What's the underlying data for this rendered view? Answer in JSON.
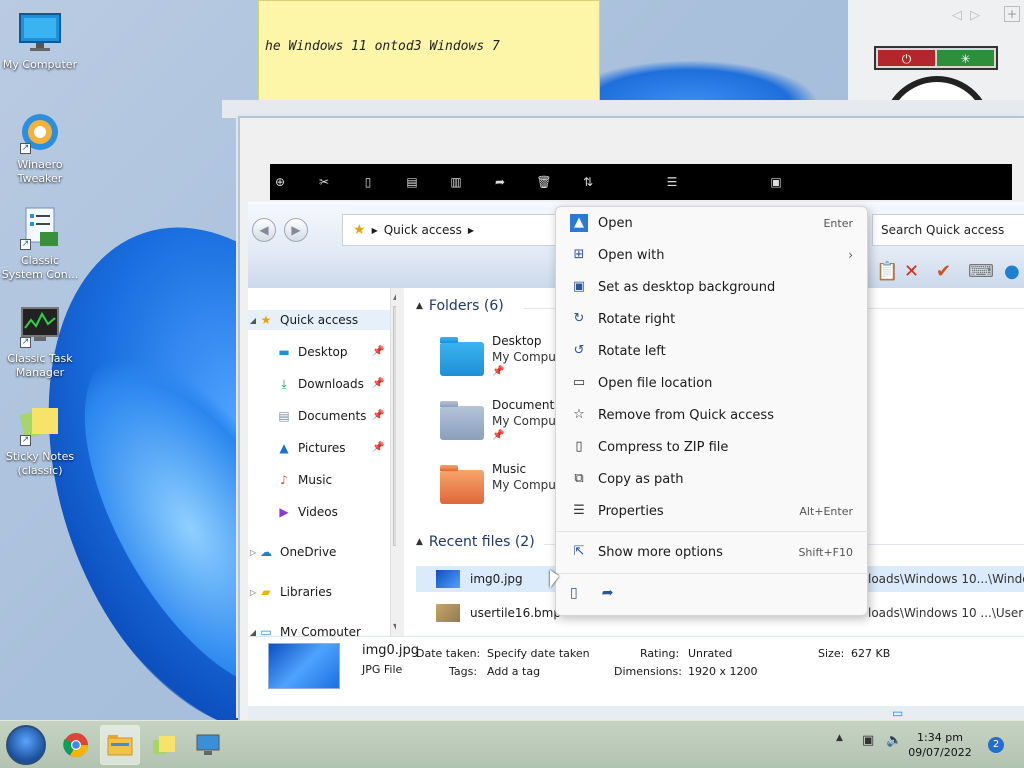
{
  "desktop": {
    "icons": [
      {
        "label": "My Computer",
        "icon": "monitor-icon"
      },
      {
        "label": "Winaero Tweaker",
        "icon": "winaero-icon"
      },
      {
        "label": "Classic System Con...",
        "icon": "control-panel-icon"
      },
      {
        "label": "Classic Task Manager",
        "icon": "task-manager-icon"
      },
      {
        "label": "Sticky Notes (classic)",
        "icon": "sticky-notes-icon"
      }
    ]
  },
  "sticky_note": {
    "text": "he Windows 11 ontod3 Windows 7"
  },
  "explorer": {
    "address": {
      "location": "Quick access"
    },
    "search": {
      "placeholder": "Search Quick access"
    },
    "nav": {
      "items": [
        {
          "label": "Quick access",
          "pinned": false
        },
        {
          "label": "Desktop",
          "pinned": true
        },
        {
          "label": "Downloads",
          "pinned": true
        },
        {
          "label": "Documents",
          "pinned": true
        },
        {
          "label": "Pictures",
          "pinned": true
        },
        {
          "label": "Music",
          "pinned": false
        },
        {
          "label": "Videos",
          "pinned": false
        },
        {
          "label": "OneDrive",
          "pinned": false
        },
        {
          "label": "Libraries",
          "pinned": false
        },
        {
          "label": "My Computer",
          "pinned": false
        }
      ]
    },
    "folders_header": "Folders (6)",
    "folders": [
      {
        "name": "Desktop",
        "location": "My Compu"
      },
      {
        "name": "Documents",
        "location": "My Compu"
      },
      {
        "name": "Music",
        "location": "My Compu"
      }
    ],
    "recent_header": "Recent files (2)",
    "recent_files": [
      {
        "name": "img0.jpg",
        "path": "loads\\Windows 10...\\Windo"
      },
      {
        "name": "usertile16.bmp",
        "path": "loads\\Windows 10 ...\\User"
      }
    ],
    "details": {
      "filename": "img0.jpg",
      "filetype": "JPG File",
      "date_taken_label": "Date taken:",
      "date_taken_value": "Specify date taken",
      "tags_label": "Tags:",
      "tags_value": "Add a tag",
      "rating_label": "Rating:",
      "rating_value": "Unrated",
      "dimensions_label": "Dimensions:",
      "dimensions_value": "1920 x 1200",
      "size_label": "Size:",
      "size_value": "627 KB"
    }
  },
  "context_menu": {
    "items": [
      {
        "label": "Open",
        "shortcut": "Enter",
        "icon": "image-icon"
      },
      {
        "label": "Open with",
        "shortcut": "",
        "icon": "open-with-icon",
        "submenu": true
      },
      {
        "label": "Set as desktop background",
        "shortcut": "",
        "icon": "wallpaper-icon"
      },
      {
        "label": "Rotate right",
        "shortcut": "",
        "icon": "rotate-right-icon"
      },
      {
        "label": "Rotate left",
        "shortcut": "",
        "icon": "rotate-left-icon"
      },
      {
        "label": "Open file location",
        "shortcut": "",
        "icon": "folder-icon"
      },
      {
        "label": "Remove from Quick access",
        "shortcut": "",
        "icon": "unpin-star-icon"
      },
      {
        "label": "Compress to ZIP file",
        "shortcut": "",
        "icon": "zip-icon"
      },
      {
        "label": "Copy as path",
        "shortcut": "",
        "icon": "copy-path-icon"
      },
      {
        "label": "Properties",
        "shortcut": "Alt+Enter",
        "icon": "properties-icon"
      }
    ],
    "more": {
      "label": "Show more options",
      "shortcut": "Shift+F10",
      "icon": "more-options-icon"
    }
  },
  "taskbar": {
    "time": "1:34 pm",
    "date": "09/07/2022",
    "notifications": "2"
  },
  "colors": {
    "accent": "#2b579a",
    "selection": "#dcebfb",
    "taskbar": "#b3c3b2"
  }
}
